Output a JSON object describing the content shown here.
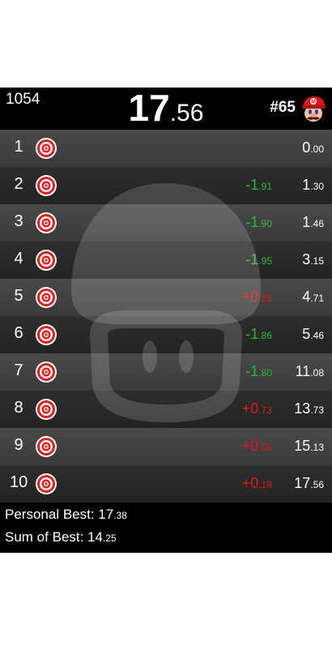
{
  "header": {
    "attempts": "1054",
    "timer_main": "17",
    "timer_frac": ".56",
    "run_number": "#65"
  },
  "splits": [
    {
      "name": "1",
      "delta": "",
      "delta_frac": "",
      "delta_state": "",
      "time": "0",
      "time_frac": ".00"
    },
    {
      "name": "2",
      "delta": "-1",
      "delta_frac": ".91",
      "delta_state": "ahead",
      "time": "1",
      "time_frac": ".30"
    },
    {
      "name": "3",
      "delta": "-1",
      "delta_frac": ".90",
      "delta_state": "ahead",
      "time": "1",
      "time_frac": ".46"
    },
    {
      "name": "4",
      "delta": "-1",
      "delta_frac": ".95",
      "delta_state": "ahead",
      "time": "3",
      "time_frac": ".15"
    },
    {
      "name": "5",
      "delta": "+0",
      "delta_frac": ".25",
      "delta_state": "behind",
      "time": "4",
      "time_frac": ".71"
    },
    {
      "name": "6",
      "delta": "-1",
      "delta_frac": ".86",
      "delta_state": "ahead",
      "time": "5",
      "time_frac": ".46"
    },
    {
      "name": "7",
      "delta": "-1",
      "delta_frac": ".80",
      "delta_state": "ahead",
      "time": "11",
      "time_frac": ".08"
    },
    {
      "name": "8",
      "delta": "+0",
      "delta_frac": ".73",
      "delta_state": "behind",
      "time": "13",
      "time_frac": ".73"
    },
    {
      "name": "9",
      "delta": "+0",
      "delta_frac": ".05",
      "delta_state": "behind",
      "time": "15",
      "time_frac": ".13"
    },
    {
      "name": "10",
      "delta": "+0",
      "delta_frac": ".18",
      "delta_state": "behind",
      "time": "17",
      "time_frac": ".56"
    }
  ],
  "footer": {
    "pb_label": "Personal Best: ",
    "pb_main": "17",
    "pb_frac": ".38",
    "sob_label": "Sum of Best: ",
    "sob_main": "14",
    "sob_frac": ".25"
  },
  "colors": {
    "ahead": "#2fb83a",
    "behind": "#e01818",
    "background": "#000000"
  },
  "icons": {
    "split_icon": "target-icon",
    "runner_icon": "mario-icon",
    "watermark": "mushroom-icon"
  }
}
